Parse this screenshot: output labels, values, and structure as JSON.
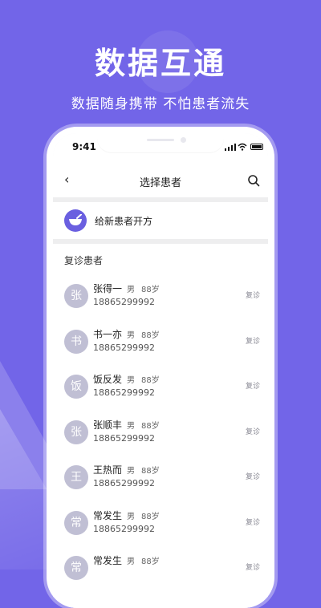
{
  "hero": {
    "title": "数据互通",
    "subtitle": "数据随身携带 不怕患者流失"
  },
  "status_bar": {
    "time": "9:41"
  },
  "nav": {
    "title": "选择患者",
    "back_icon": "chevron-left-icon",
    "search_icon": "search-icon"
  },
  "new_patient": {
    "label": "给新患者开方",
    "icon": "mortar-bowl-icon"
  },
  "list": {
    "section_title": "复诊患者",
    "patients": [
      {
        "avatar": "张",
        "name": "张得一",
        "gender": "男",
        "age": "88岁",
        "phone": "18865299992",
        "action": "复诊"
      },
      {
        "avatar": "书",
        "name": "书一亦",
        "gender": "男",
        "age": "88岁",
        "phone": "18865299992",
        "action": "复诊"
      },
      {
        "avatar": "饭",
        "name": "饭反发",
        "gender": "男",
        "age": "88岁",
        "phone": "18865299992",
        "action": "复诊"
      },
      {
        "avatar": "张",
        "name": "张顺丰",
        "gender": "男",
        "age": "88岁",
        "phone": "18865299992",
        "action": "复诊"
      },
      {
        "avatar": "王",
        "name": "王热而",
        "gender": "男",
        "age": "88岁",
        "phone": "18865299992",
        "action": "复诊"
      },
      {
        "avatar": "常",
        "name": "常发生",
        "gender": "男",
        "age": "88岁",
        "phone": "18865299992",
        "action": "复诊"
      },
      {
        "avatar": "常",
        "name": "常发生",
        "gender": "男",
        "age": "88岁",
        "phone": "",
        "action": "复诊"
      }
    ]
  },
  "colors": {
    "background": "#7265e8",
    "accent": "#6a5fe0",
    "avatar": "#c0bfd4"
  }
}
